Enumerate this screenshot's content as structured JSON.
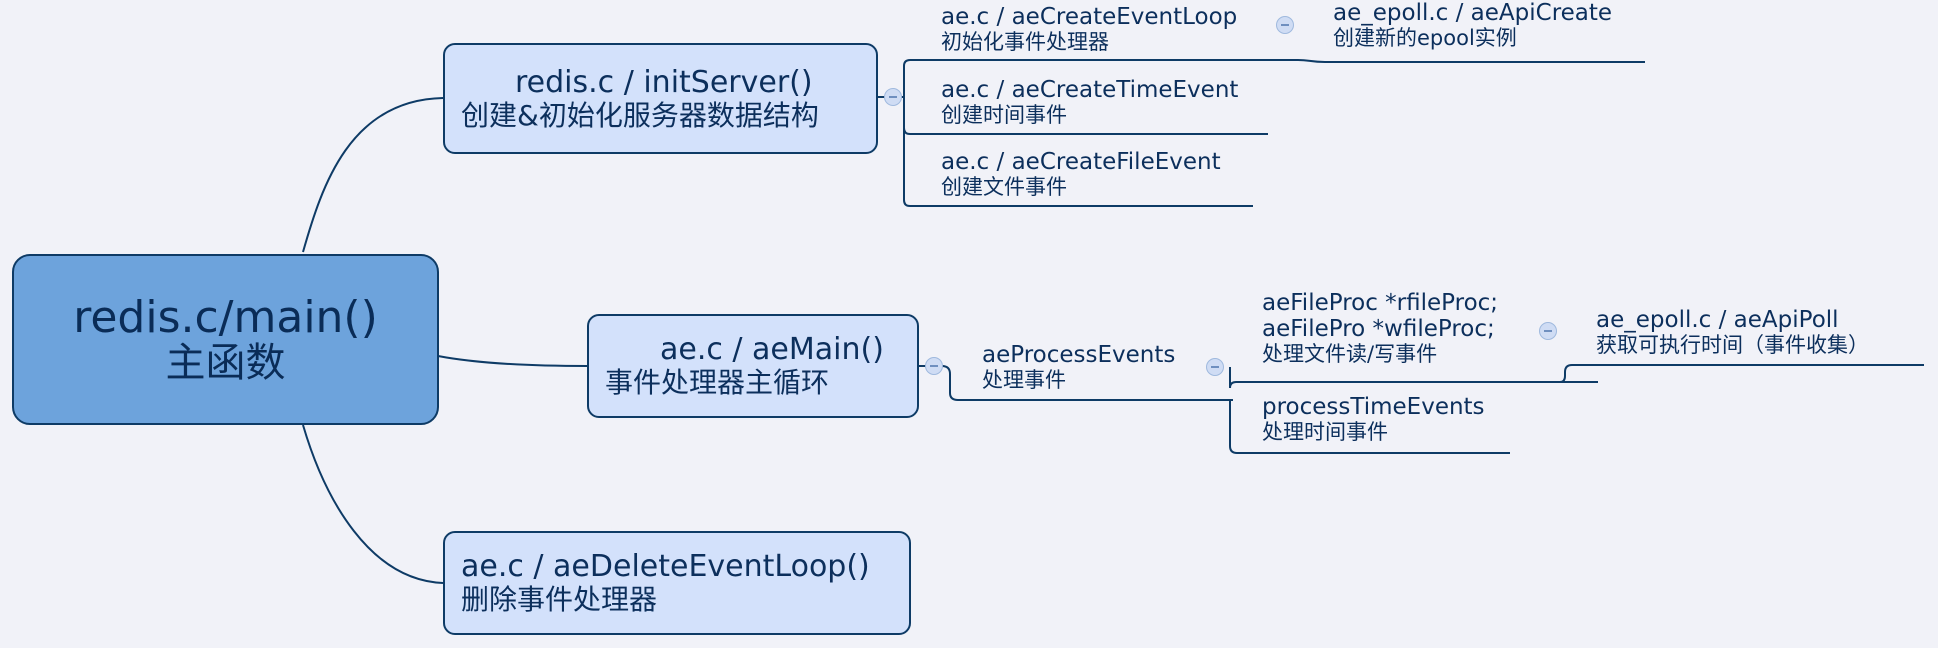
{
  "root": {
    "title": "redis.c/main()",
    "subtitle": "主函数"
  },
  "init_server": {
    "title": "redis.c / initServer()",
    "subtitle": "创建&初始化服务器数据结构"
  },
  "create_event_loop": {
    "title": "ae.c / aeCreateEventLoop",
    "subtitle": "初始化事件处理器"
  },
  "api_create": {
    "title": "ae_epoll.c / aeApiCreate",
    "subtitle": "创建新的epool实例"
  },
  "create_time_event": {
    "title": "ae.c / aeCreateTimeEvent",
    "subtitle": "创建时间事件"
  },
  "create_file_event": {
    "title": "ae.c / aeCreateFileEvent",
    "subtitle": "创建文件事件"
  },
  "ae_main": {
    "title": "ae.c / aeMain()",
    "subtitle": "事件处理器主循环"
  },
  "process_events": {
    "title": "aeProcessEvents",
    "subtitle": "处理事件"
  },
  "file_proc": {
    "line1": "aeFileProc *rfileProc;",
    "line2": "aeFilePro *wfileProc;",
    "subtitle": "处理文件读/写事件"
  },
  "api_poll": {
    "title": "ae_epoll.c / aeApiPoll",
    "subtitle": "获取可执行时间（事件收集）"
  },
  "process_time_events": {
    "title": "processTimeEvents",
    "subtitle": "处理时间事件"
  },
  "delete_event_loop": {
    "title": "ae.c / aeDeleteEventLoop()",
    "subtitle": "删除事件处理器"
  },
  "colors": {
    "connector": "#0e3b66",
    "root_fill": "#6da3dc",
    "node_fill": "#d3e1fb",
    "background": "#f1f2f8"
  }
}
